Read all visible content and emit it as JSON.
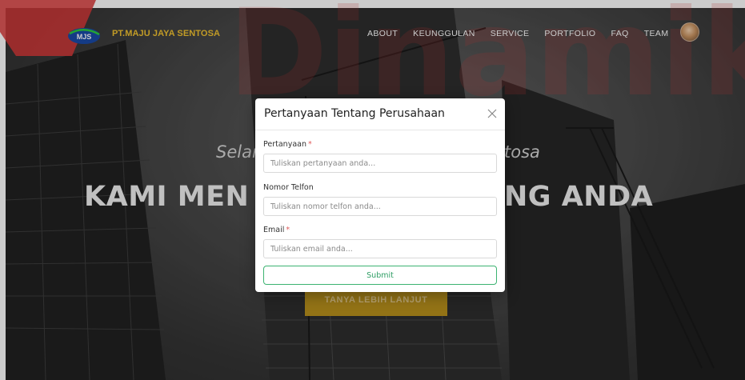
{
  "brand": {
    "logo_text": "MJS",
    "name": "PT.MAJU JAYA SENTOSA"
  },
  "watermark": {
    "text": "Dinamik",
    "color": "#d93a3a"
  },
  "nav": {
    "items": [
      "ABOUT",
      "KEUNGGULAN",
      "SERVICE",
      "PORTFOLIO",
      "FAQ",
      "TEAM"
    ]
  },
  "hero": {
    "subtitle_left": "Selan",
    "subtitle_right": "tosa",
    "title_left": "KAMI MEN",
    "title_right": "NG ANDA",
    "cta_label": "TANYA LEBIH LANJUT",
    "cta_color": "#b8901c"
  },
  "modal": {
    "title": "Pertanyaan Tentang Perusahaan",
    "close_icon": "close-icon",
    "fields": {
      "question": {
        "label": "Pertanyaan",
        "required_mark": "*",
        "placeholder": "Tuliskan pertanyaan anda..."
      },
      "phone": {
        "label": "Nomor Telfon",
        "placeholder": "Tuliskan nomor telfon anda..."
      },
      "email": {
        "label": "Email",
        "required_mark": "*",
        "placeholder": "Tuliskan email anda..."
      }
    },
    "submit_label": "Submit",
    "submit_color": "#3cb371"
  },
  "colors": {
    "brand_yellow": "#f2c230",
    "required_red": "#e05c5c"
  }
}
